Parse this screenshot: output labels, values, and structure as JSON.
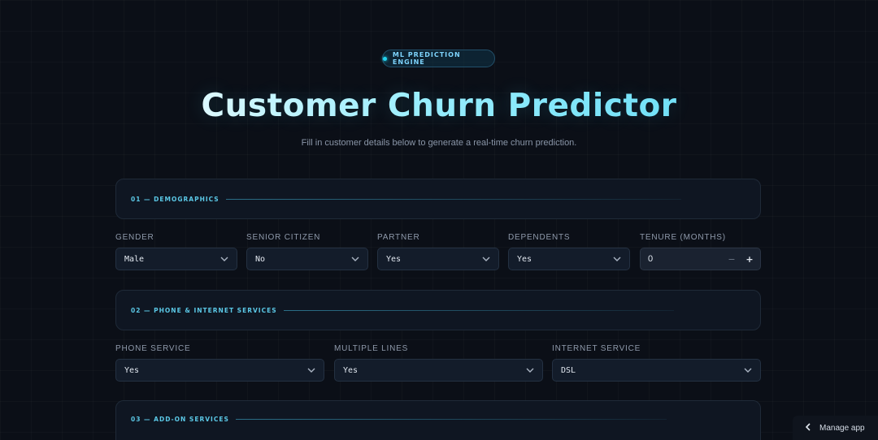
{
  "badge": {
    "label": "ML PREDICTION ENGINE"
  },
  "title": "Customer Churn Predictor",
  "subtitle": "Fill in customer details below to generate a real-time churn prediction.",
  "sections": [
    {
      "label": "01 — DEMOGRAPHICS"
    },
    {
      "label": "02 — PHONE & INTERNET SERVICES"
    },
    {
      "label": "03 — ADD-ON SERVICES"
    }
  ],
  "demographics": {
    "gender": {
      "label": "GENDER",
      "value": "Male"
    },
    "senior_citizen": {
      "label": "SENIOR CITIZEN",
      "value": "No"
    },
    "partner": {
      "label": "PARTNER",
      "value": "Yes"
    },
    "dependents": {
      "label": "DEPENDENTS",
      "value": "Yes"
    },
    "tenure": {
      "label": "TENURE (MONTHS)",
      "value": "0",
      "minus": "−",
      "plus": "+"
    }
  },
  "services": {
    "phone_service": {
      "label": "PHONE SERVICE",
      "value": "Yes"
    },
    "multiple_lines": {
      "label": "MULTIPLE LINES",
      "value": "Yes"
    },
    "internet_service": {
      "label": "INTERNET SERVICE",
      "value": "DSL"
    }
  },
  "manage_app": {
    "label": "Manage app",
    "icon": "chevron-left-icon"
  },
  "colors": {
    "accent": "#22d3ee",
    "background": "#0b0f17",
    "panel": "#0f1622"
  }
}
